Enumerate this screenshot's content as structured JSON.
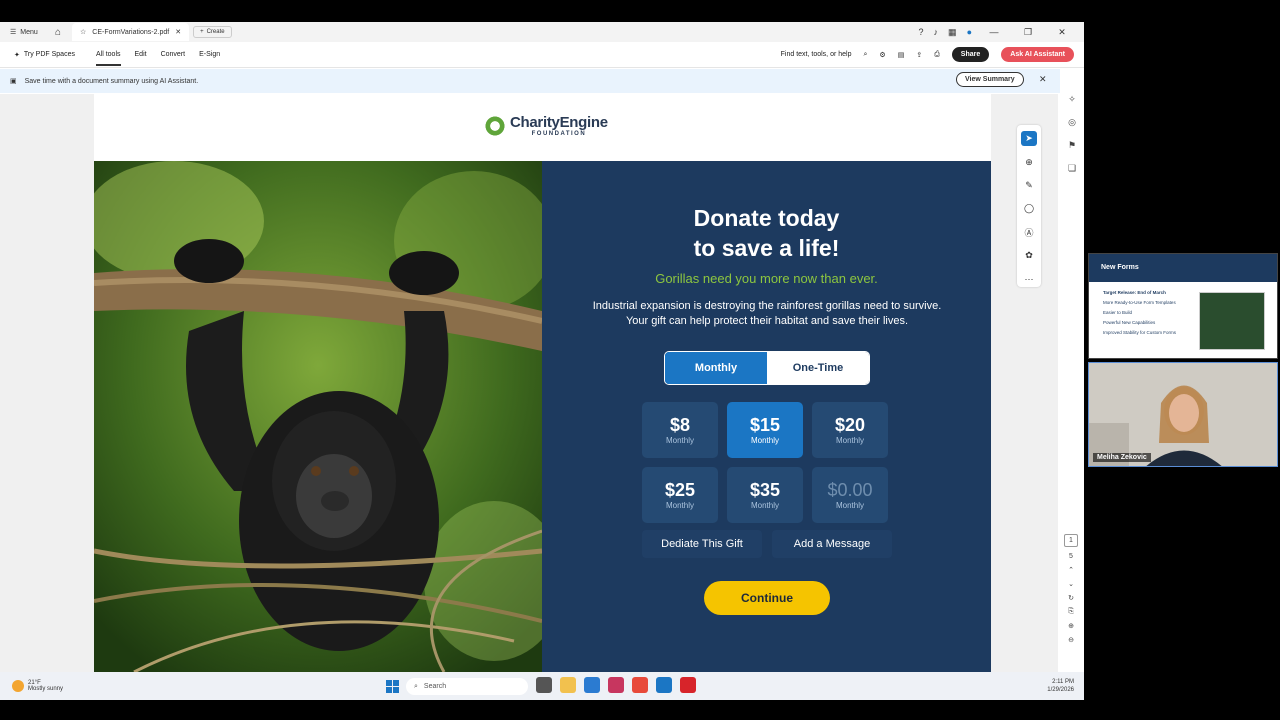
{
  "window": {
    "menu_label": "Menu",
    "tab_title": "CE-FormVariations-2.pdf",
    "create_label": "Create"
  },
  "toolbar": {
    "spaces_label": "Try PDF Spaces",
    "items": [
      "All tools",
      "Edit",
      "Convert",
      "E-Sign"
    ],
    "search_label": "Find text, tools, or help",
    "share_label": "Share",
    "ai_label": "Ask AI Assistant"
  },
  "banner": {
    "text": "Save time with a document summary using AI Assistant.",
    "button_label": "View Summary"
  },
  "document": {
    "logo_name": "CharityEngine",
    "logo_sub": "FOUNDATION",
    "headline_1": "Donate today",
    "headline_2": "to save a life!",
    "subhead": "Gorillas need you more now than ever.",
    "body": "Industrial expansion is destroying the rainforest gorillas need to survive. Your gift can help protect their habitat and save their lives.",
    "frequency": {
      "monthly": "Monthly",
      "one_time": "One-Time",
      "selected": "Monthly"
    },
    "amounts": [
      {
        "value": "$8",
        "period": "Monthly",
        "selected": false
      },
      {
        "value": "$15",
        "period": "Monthly",
        "selected": true
      },
      {
        "value": "$20",
        "period": "Monthly",
        "selected": false
      },
      {
        "value": "$25",
        "period": "Monthly",
        "selected": false
      },
      {
        "value": "$35",
        "period": "Monthly",
        "selected": false
      },
      {
        "value": "$0.00",
        "period": "Monthly",
        "selected": false
      }
    ],
    "dedicate_label": "Dediate This Gift",
    "message_label": "Add a Message",
    "continue_label": "Continue"
  },
  "pager": {
    "current": "1",
    "total": "5"
  },
  "taskbar": {
    "temp": "21°F",
    "condition": "Mostly sunny",
    "search_placeholder": "Search",
    "time": "2:11 PM",
    "date": "1/29/2026"
  },
  "meeting": {
    "slide_title": "New Forms",
    "slide_lines": [
      "Target Release: End of March",
      "More Ready-to-Use Form Templates",
      "Easier to Build",
      "Powerful New Capabilities",
      "Improved Stability for Custom Forms"
    ],
    "participant_name": "Meliha Zekovic"
  },
  "colors": {
    "panel_bg": "#1d3a5f",
    "accent_blue": "#1b76c4",
    "accent_green": "#8dc63f",
    "continue_yellow": "#f5c400",
    "ai_button": "#e8515a"
  }
}
